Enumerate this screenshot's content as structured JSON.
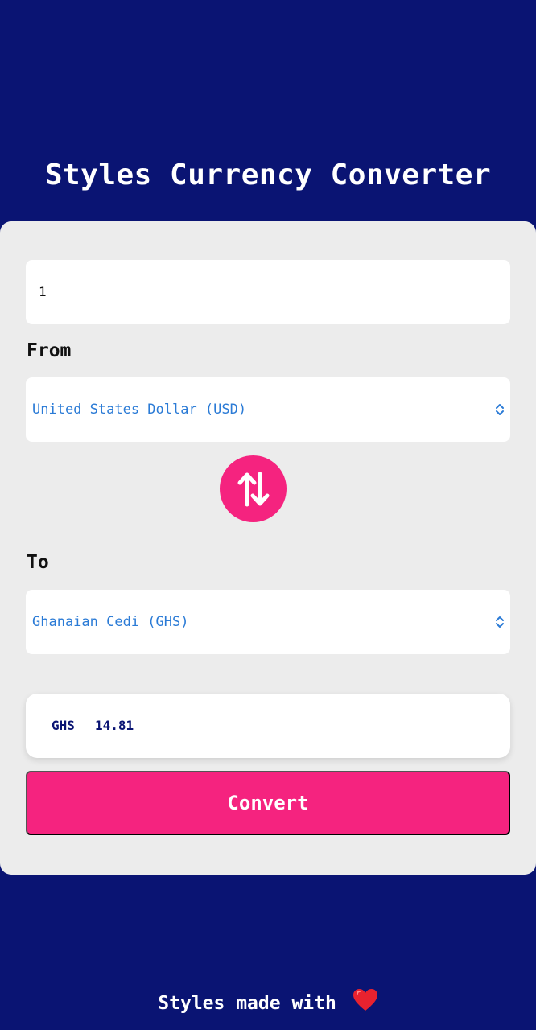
{
  "header": {
    "title": "Styles Currency Converter"
  },
  "amount": {
    "value": "1"
  },
  "from": {
    "label": "From",
    "selected": "United States Dollar (USD)"
  },
  "to": {
    "label": "To",
    "selected": "Ghanaian Cedi (GHS)"
  },
  "swap": {
    "icon": "swap-vertical-icon"
  },
  "result": {
    "currency": "GHS",
    "amount": "14.81"
  },
  "convert": {
    "label": "Convert"
  },
  "footer": {
    "text": "Styles made with",
    "icon": "heart-icon"
  },
  "colors": {
    "background": "#0a1473",
    "card": "#ececec",
    "accent": "#f5237f",
    "select_text": "#2b7bd6",
    "result_text": "#0a1473"
  }
}
